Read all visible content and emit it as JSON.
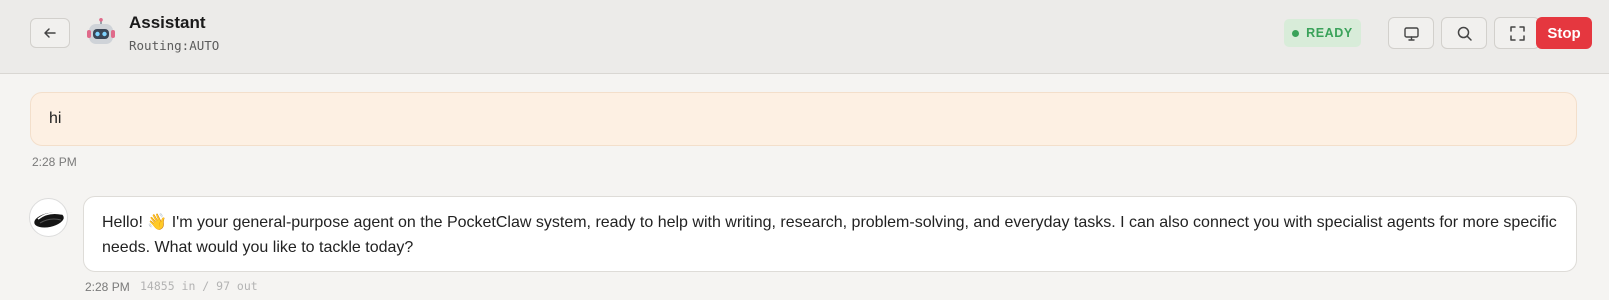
{
  "header": {
    "back_icon": "arrow-left-icon",
    "avatar_icon": "robot-icon",
    "title": "Assistant",
    "routing": "Routing:AUTO",
    "status": {
      "label": "READY",
      "color": "#3aa25a"
    },
    "buttons": {
      "screen_icon": "monitor-icon",
      "search_icon": "search-icon",
      "expand_icon": "fullscreen-icon",
      "stop_label": "Stop"
    }
  },
  "messages": [
    {
      "role": "user",
      "text": "hi",
      "time": "2:28 PM"
    },
    {
      "role": "assistant",
      "avatar_icon": "agent-avatar-icon",
      "text_before_emoji": "Hello! ",
      "emoji": "👋",
      "text_after_emoji": " I'm your general-purpose agent on the PocketClaw system, ready to help with writing, research, problem-solving, and everyday tasks. I can also connect you with specialist agents for more specific needs. What would you like to tackle today?",
      "time": "2:28 PM",
      "tokens": "14855 in / 97 out"
    }
  ],
  "colors": {
    "accent_stop": "#e5373f",
    "user_bubble": "#fdf0e3"
  }
}
